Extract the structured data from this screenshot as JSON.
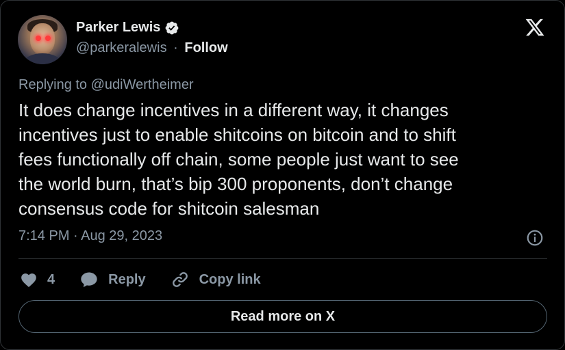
{
  "author": {
    "name": "Parker Lewis",
    "handle": "@parkeralewis",
    "separator": "·",
    "follow_label": "Follow",
    "verified": true
  },
  "tweet": {
    "replying_to": "Replying to @udiWertheimer",
    "text_lines": [
      "It does change incentives in a different way, it changes",
      "incentives just to enable shitcoins on bitcoin and to shift",
      "fees functionally off chain, some people just want to see",
      "the world burn, that’s bip 300 proponents, don’t change",
      "consensus code for shitcoin salesman"
    ],
    "timestamp": "7:14 PM · Aug 29, 2023"
  },
  "actions": {
    "like_count": "4",
    "reply_label": "Reply",
    "copy_link_label": "Copy link"
  },
  "read_more_label": "Read more on X",
  "icons": {
    "verified": "verified-badge-icon",
    "x_logo": "x-logo-icon",
    "info": "info-icon",
    "heart": "heart-icon",
    "reply": "speech-bubble-icon",
    "link": "link-icon"
  },
  "colors": {
    "background": "#000000",
    "text": "#e7e9ea",
    "secondary": "#8b98a5",
    "border": "#2f3336"
  }
}
